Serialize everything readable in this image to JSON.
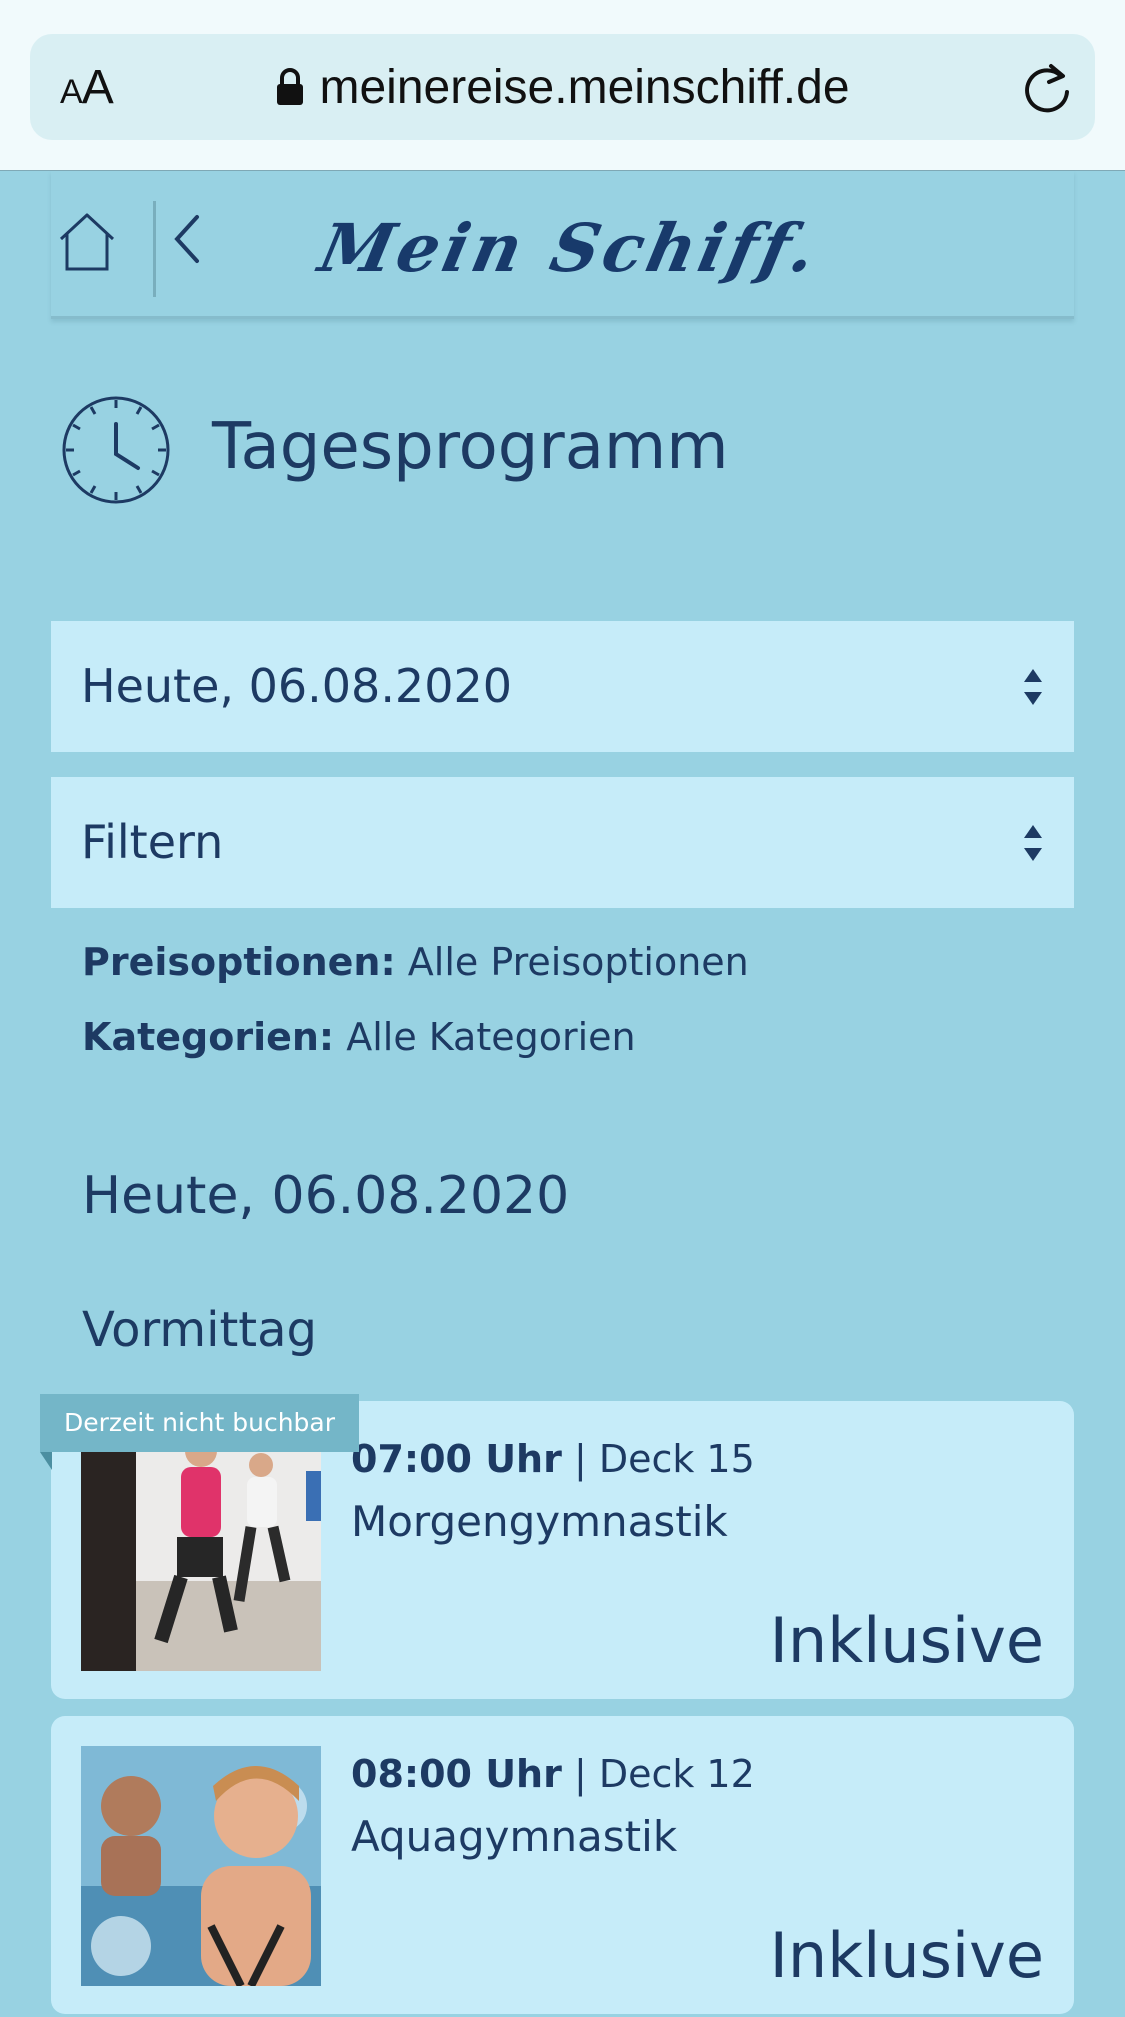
{
  "browser": {
    "text_size_label_small": "A",
    "text_size_label_large": "A",
    "url": "meinereise.meinschiff.de",
    "icons": [
      "lock-icon",
      "reload-icon"
    ]
  },
  "header": {
    "logo_text": "Mein Schiff.",
    "icons": [
      "home-icon",
      "back-icon"
    ]
  },
  "page": {
    "title": "Tagesprogramm",
    "title_icon": "clock-icon"
  },
  "date_select": {
    "value": "Heute, 06.08.2020"
  },
  "filter_select": {
    "value": "Filtern"
  },
  "filters": {
    "price_label": "Preisoptionen:",
    "price_value": "Alle Preisoptionen",
    "category_label": "Kategorien:",
    "category_value": "Alle Kategorien"
  },
  "schedule": {
    "day_heading": "Heute, 06.08.2020",
    "section_heading": "Vormittag",
    "events": [
      {
        "badge": "Derzeit nicht buchbar",
        "time": "07:00 Uhr",
        "location": "| Deck 15",
        "title": "Morgengymnastik",
        "price": "Inklusive"
      },
      {
        "time": "08:00 Uhr",
        "location": "| Deck 12",
        "title": "Aquagymnastik",
        "price": "Inklusive"
      }
    ]
  },
  "colors": {
    "background": "#98d2e2",
    "card": "#c6ecf9",
    "text": "#1d3a63",
    "badge": "#74b6c8"
  }
}
